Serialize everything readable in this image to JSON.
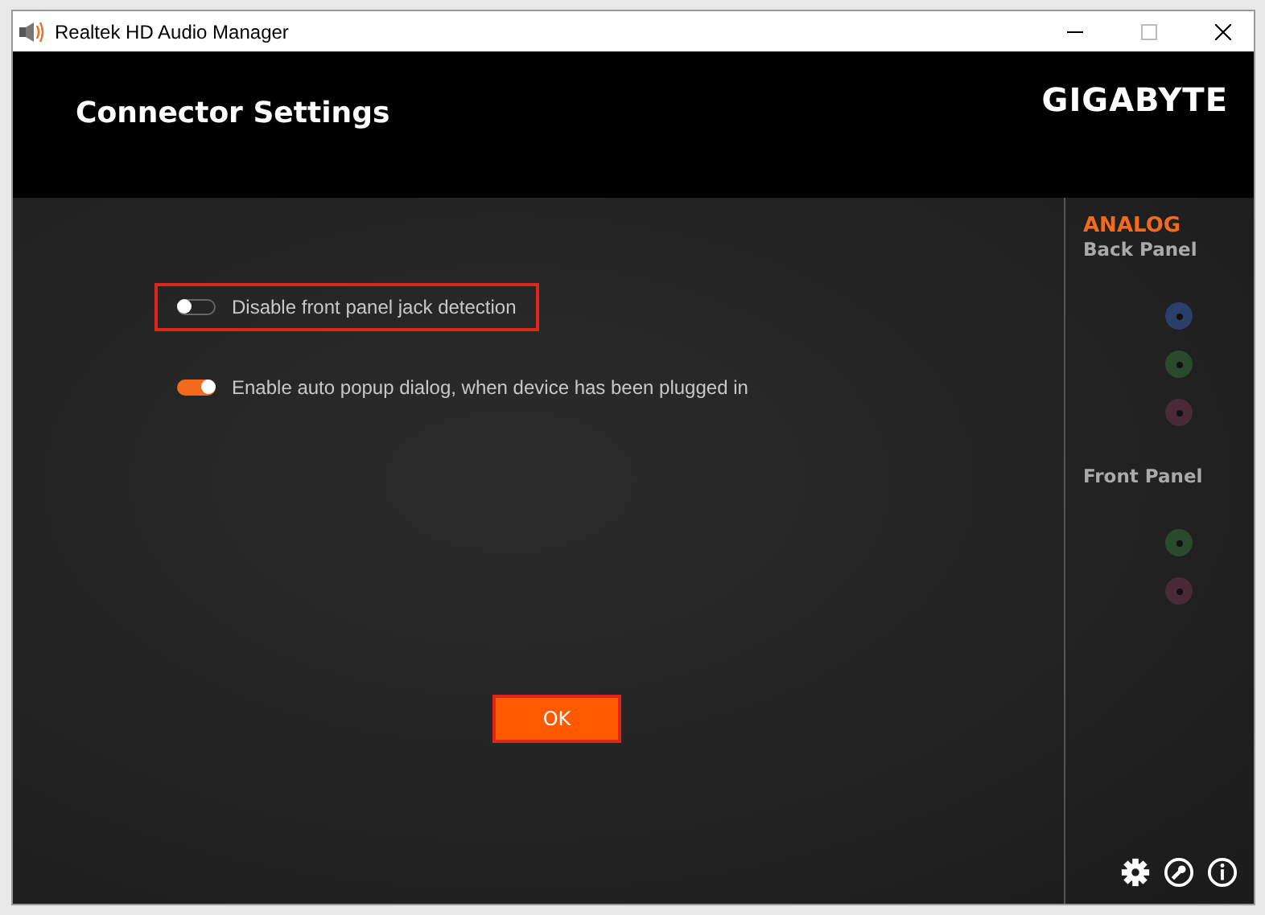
{
  "window": {
    "title": "Realtek HD Audio Manager"
  },
  "header": {
    "title": "Connector Settings",
    "logo": "GIGABYTE"
  },
  "options": [
    {
      "label": "Disable front panel jack detection",
      "on": false,
      "highlighted": true
    },
    {
      "label": "Enable auto popup dialog, when device has been plugged in",
      "on": true,
      "highlighted": false
    }
  ],
  "ok_button": {
    "label": "OK",
    "highlighted": true
  },
  "sidebar": {
    "heading": "ANALOG",
    "sections": [
      {
        "title": "Back Panel",
        "jacks": [
          {
            "color": "#2a3f6a"
          },
          {
            "color": "#2a4a2e"
          },
          {
            "color": "#4a2a36"
          }
        ]
      },
      {
        "title": "Front Panel",
        "jacks": [
          {
            "color": "#2a4a2e"
          },
          {
            "color": "#4a2a36"
          }
        ]
      }
    ]
  }
}
